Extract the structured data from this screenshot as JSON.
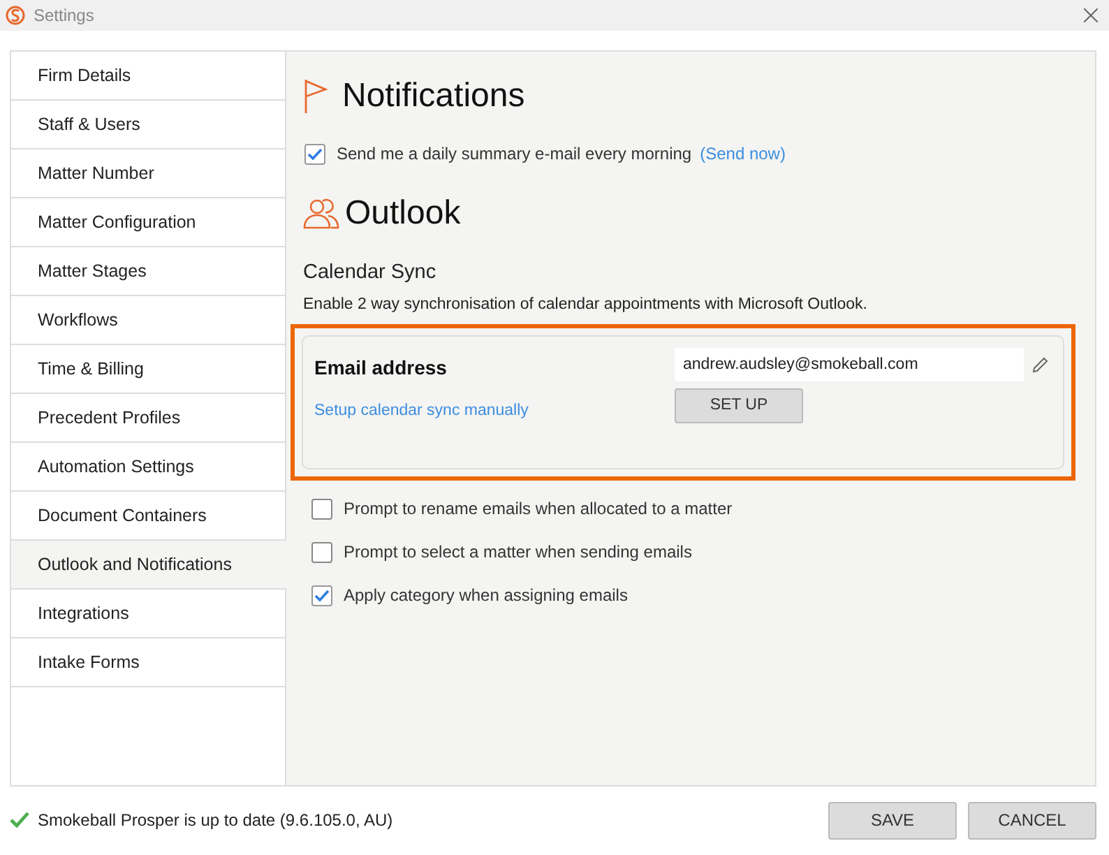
{
  "window": {
    "title": "Settings"
  },
  "sidebar": {
    "items": [
      {
        "label": "Firm Details",
        "selected": false
      },
      {
        "label": "Staff & Users",
        "selected": false
      },
      {
        "label": "Matter Number",
        "selected": false
      },
      {
        "label": "Matter Configuration",
        "selected": false
      },
      {
        "label": "Matter Stages",
        "selected": false
      },
      {
        "label": "Workflows",
        "selected": false
      },
      {
        "label": "Time & Billing",
        "selected": false
      },
      {
        "label": "Precedent Profiles",
        "selected": false
      },
      {
        "label": "Automation Settings",
        "selected": false
      },
      {
        "label": "Document Containers",
        "selected": false
      },
      {
        "label": "Outlook and Notifications",
        "selected": true
      },
      {
        "label": "Integrations",
        "selected": false
      },
      {
        "label": "Intake Forms",
        "selected": false
      }
    ]
  },
  "notifications": {
    "heading": "Notifications",
    "daily_summary": {
      "label": "Send me a daily summary e-mail every morning",
      "checked": true,
      "link": "(Send now)"
    }
  },
  "outlook": {
    "heading": "Outlook",
    "calendar_sync": {
      "title": "Calendar Sync",
      "description": "Enable 2 way synchronisation of calendar appointments with Microsoft Outlook.",
      "highlighted": true,
      "email_label": "Email address",
      "email_value": "andrew.audsley@smokeball.com",
      "manual_link": "Setup calendar sync manually",
      "setup_button": "SET UP"
    },
    "options": [
      {
        "label": "Prompt to rename emails when allocated to a matter",
        "checked": false
      },
      {
        "label": "Prompt to select a matter when sending emails",
        "checked": false
      },
      {
        "label": "Apply category when assigning emails",
        "checked": true
      }
    ]
  },
  "status": "Smokeball Prosper is up to date (9.6.105.0, AU)",
  "buttons": [
    "SAVE",
    "CANCEL"
  ]
}
